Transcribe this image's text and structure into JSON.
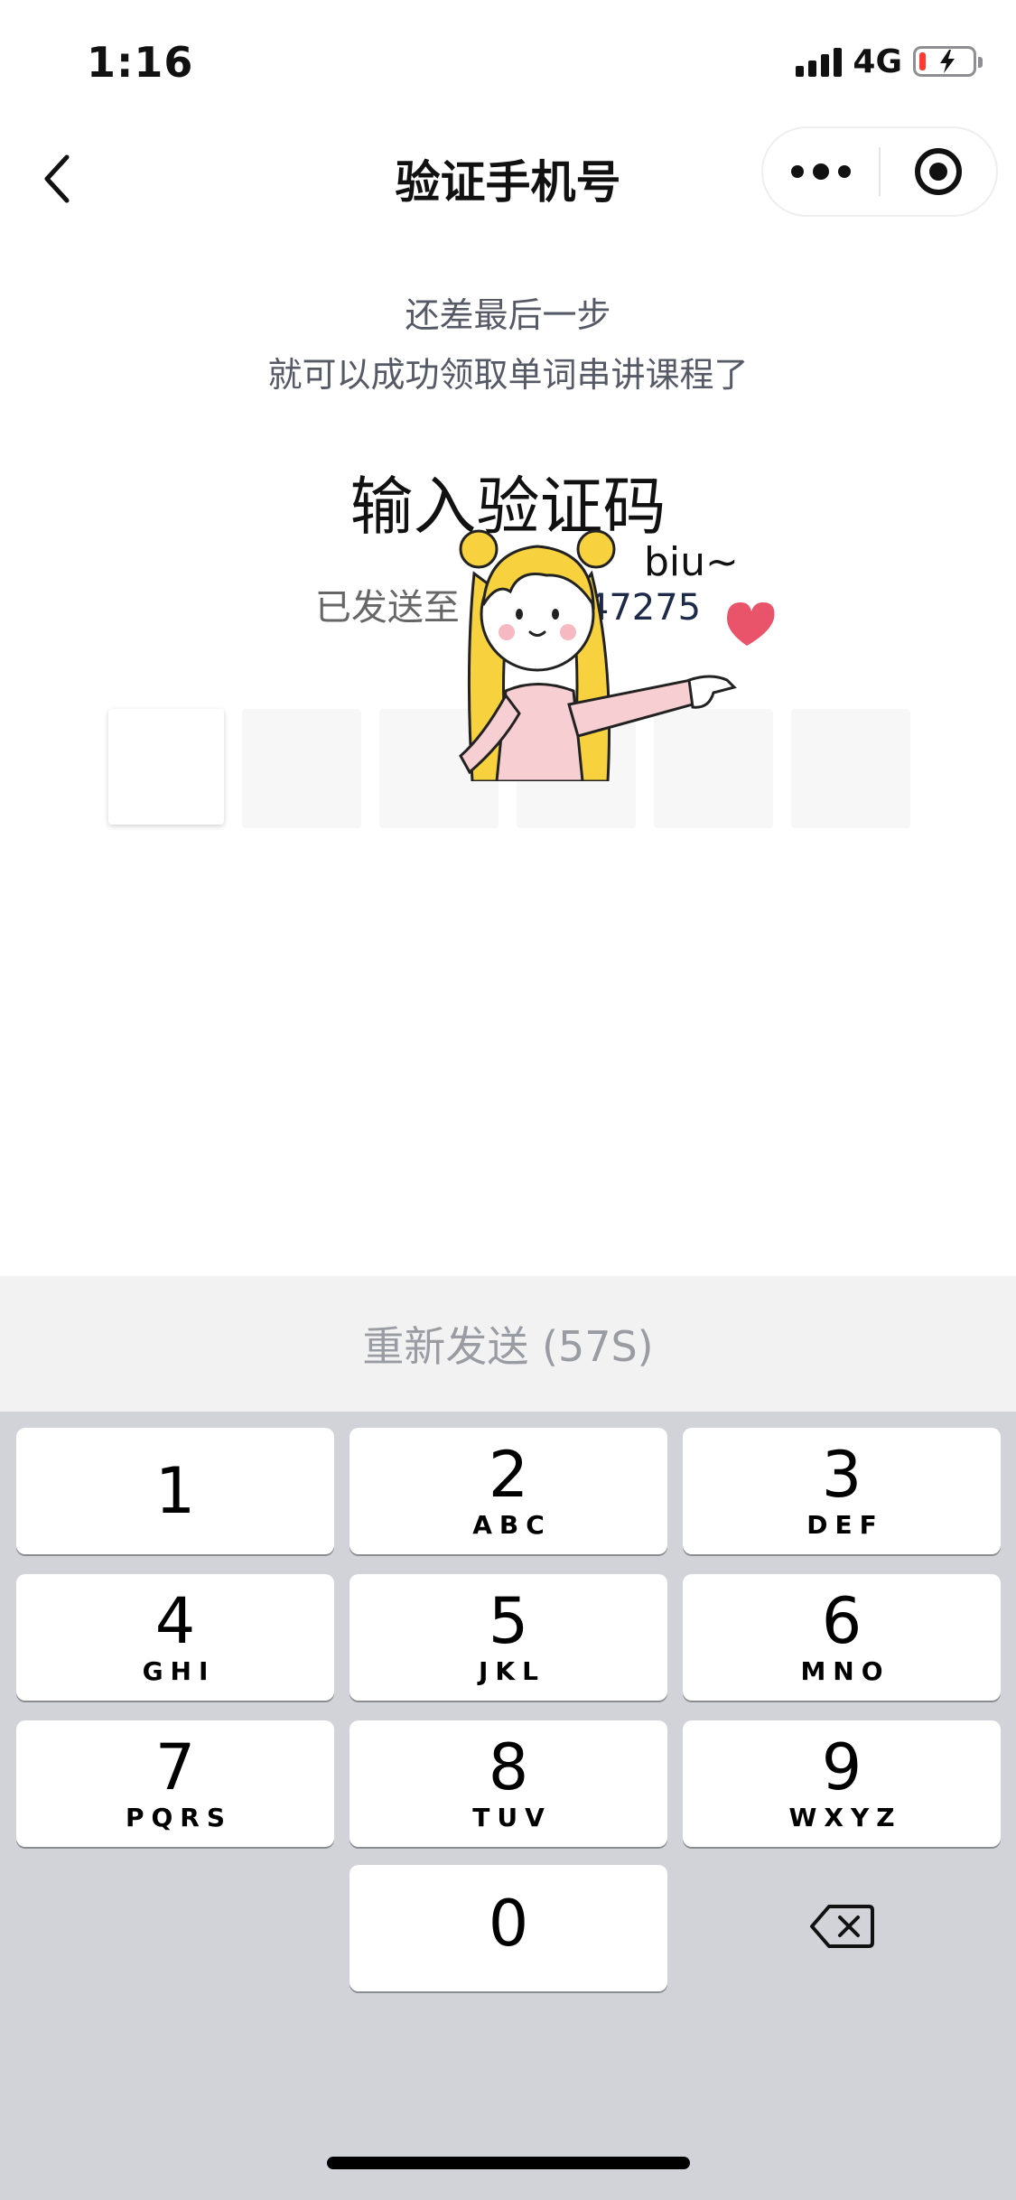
{
  "status_bar": {
    "time": "1:16",
    "network": "4G"
  },
  "nav": {
    "title": "验证手机号"
  },
  "content": {
    "subtitle_line1": "还差最后一步",
    "subtitle_line2": "就可以成功领取单词串讲课程了",
    "heading": "输入验证码",
    "sent_to_label": "已发送至",
    "phone_partial": "47275",
    "code_box_count": 6
  },
  "sticker": {
    "text": "biu~"
  },
  "resend": {
    "label": "重新发送 (57S)"
  },
  "keyboard": {
    "keys": [
      {
        "digit": "1",
        "letters": ""
      },
      {
        "digit": "2",
        "letters": "ABC"
      },
      {
        "digit": "3",
        "letters": "DEF"
      },
      {
        "digit": "4",
        "letters": "GHI"
      },
      {
        "digit": "5",
        "letters": "JKL"
      },
      {
        "digit": "6",
        "letters": "MNO"
      },
      {
        "digit": "7",
        "letters": "PQRS"
      },
      {
        "digit": "8",
        "letters": "TUV"
      },
      {
        "digit": "9",
        "letters": "WXYZ"
      },
      {
        "digit": "0",
        "letters": ""
      }
    ],
    "delete_icon": "backspace-icon"
  },
  "colors": {
    "accent_red": "#ff3b30",
    "keyboard_bg": "#d1d3d9",
    "resend_bg": "#f2f2f3",
    "resend_text": "#9a9ca3"
  }
}
